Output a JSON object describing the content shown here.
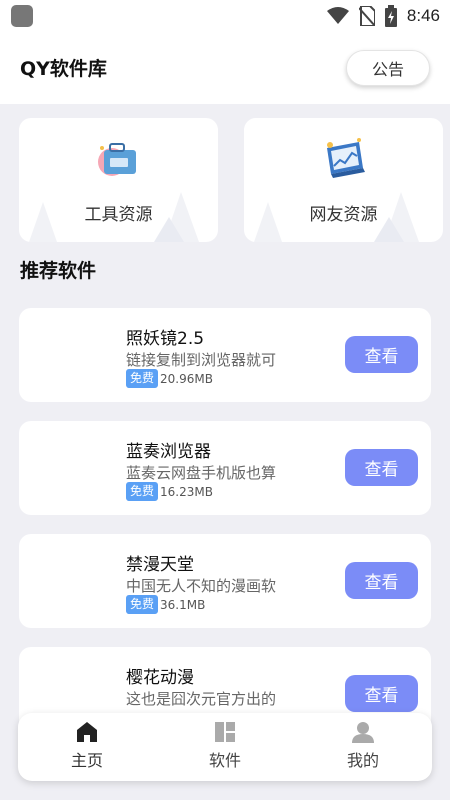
{
  "status_bar": {
    "time": "8:46",
    "icons": [
      "wifi-icon",
      "no-sim-icon",
      "battery-charging-icon"
    ]
  },
  "header": {
    "title": "QY软件库",
    "notice_label": "公告"
  },
  "categories": [
    {
      "label": "工具资源",
      "icon": "toolbox-icon"
    },
    {
      "label": "网友资源",
      "icon": "laptop-chart-icon"
    }
  ],
  "section": {
    "title": "推荐软件"
  },
  "apps": [
    {
      "name": "照妖镜2.5",
      "description": "链接复制到浏览器就可",
      "badge": "免费",
      "size": "20.96MB",
      "action": "查看"
    },
    {
      "name": "蓝奏浏览器",
      "description": "蓝奏云网盘手机版也算",
      "badge": "免费",
      "size": "16.23MB",
      "action": "查看"
    },
    {
      "name": "禁漫天堂",
      "description": "中国无人不知的漫画软",
      "badge": "免费",
      "size": "36.1MB",
      "action": "查看"
    },
    {
      "name": "樱花动漫",
      "description": "这也是囧次元官方出的",
      "badge": "",
      "size": "",
      "action": "查看"
    }
  ],
  "tabbar": {
    "items": [
      {
        "label": "主页",
        "icon": "home-icon",
        "active": true
      },
      {
        "label": "软件",
        "icon": "apps-grid-icon",
        "active": false
      },
      {
        "label": "我的",
        "icon": "user-icon",
        "active": false
      }
    ]
  },
  "colors": {
    "accent": "#7b8cf7",
    "badge": "#5aa0f5",
    "background": "#efeff4"
  }
}
